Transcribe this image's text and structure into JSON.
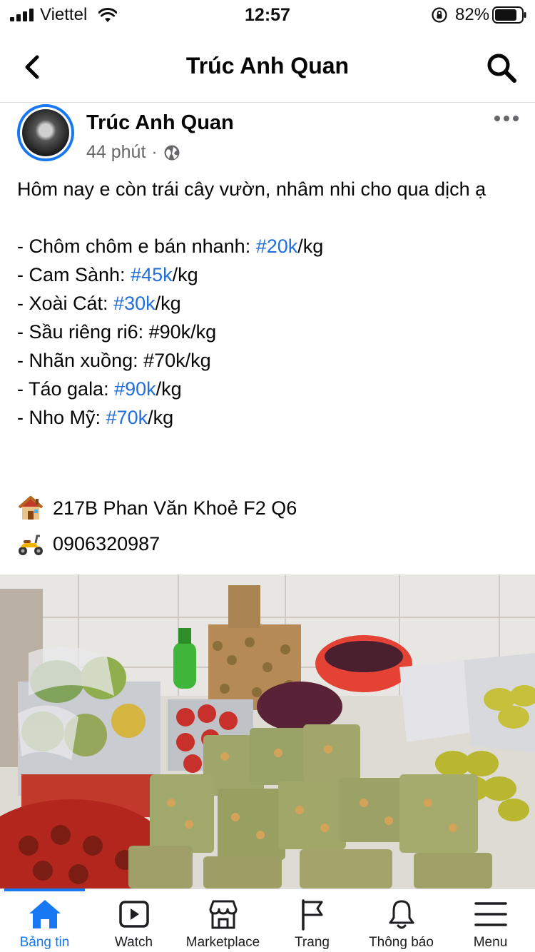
{
  "status_bar": {
    "carrier": "Viettel",
    "time": "12:57",
    "battery": "82%",
    "battery_level": 0.82
  },
  "header": {
    "title": "Trúc Anh Quan",
    "back_icon": "chevron-left-icon",
    "search_icon": "search-icon"
  },
  "post": {
    "author": "Trúc Anh Quan",
    "time": "44 phút",
    "separator": "·",
    "intro": "Hôm nay e còn trái cây vườn, nhâm nhi cho qua dịch ạ",
    "items": [
      {
        "label": "- Chôm chôm e bán nhanh: ",
        "hashtag": "#20k",
        "suffix": "/kg"
      },
      {
        "label": "- Cam Sành: ",
        "hashtag": "#45k",
        "suffix": "/kg"
      },
      {
        "label": "- Xoài Cát: ",
        "hashtag": "#30k",
        "suffix": "/kg"
      },
      {
        "label": "- Sầu riêng ri6: #90k/kg",
        "hashtag": "",
        "suffix": ""
      },
      {
        "label": "- Nhãn xuồng: #70k/kg",
        "hashtag": "",
        "suffix": ""
      },
      {
        "label": "- Táo gala: ",
        "hashtag": "#90k",
        "suffix": "/kg"
      },
      {
        "label": "- Nho Mỹ: ",
        "hashtag": "#70k",
        "suffix": "/kg"
      }
    ],
    "address": "217B Phan Văn Khoẻ F2 Q6",
    "phone": "0906320987",
    "address_icon": "house-emoji-icon",
    "phone_icon": "scooter-emoji-icon"
  },
  "tabs": [
    {
      "label": "Bảng tin",
      "icon": "home-icon",
      "active": true
    },
    {
      "label": "Watch",
      "icon": "watch-icon",
      "active": false
    },
    {
      "label": "Marketplace",
      "icon": "marketplace-icon",
      "active": false
    },
    {
      "label": "Trang",
      "icon": "flag-icon",
      "active": false
    },
    {
      "label": "Thông báo",
      "icon": "bell-icon",
      "active": false
    },
    {
      "label": "Menu",
      "icon": "menu-icon",
      "active": false
    }
  ],
  "colors": {
    "accent": "#1877f2",
    "hashtag": "#216fdb",
    "secondary_text": "#65676b"
  }
}
